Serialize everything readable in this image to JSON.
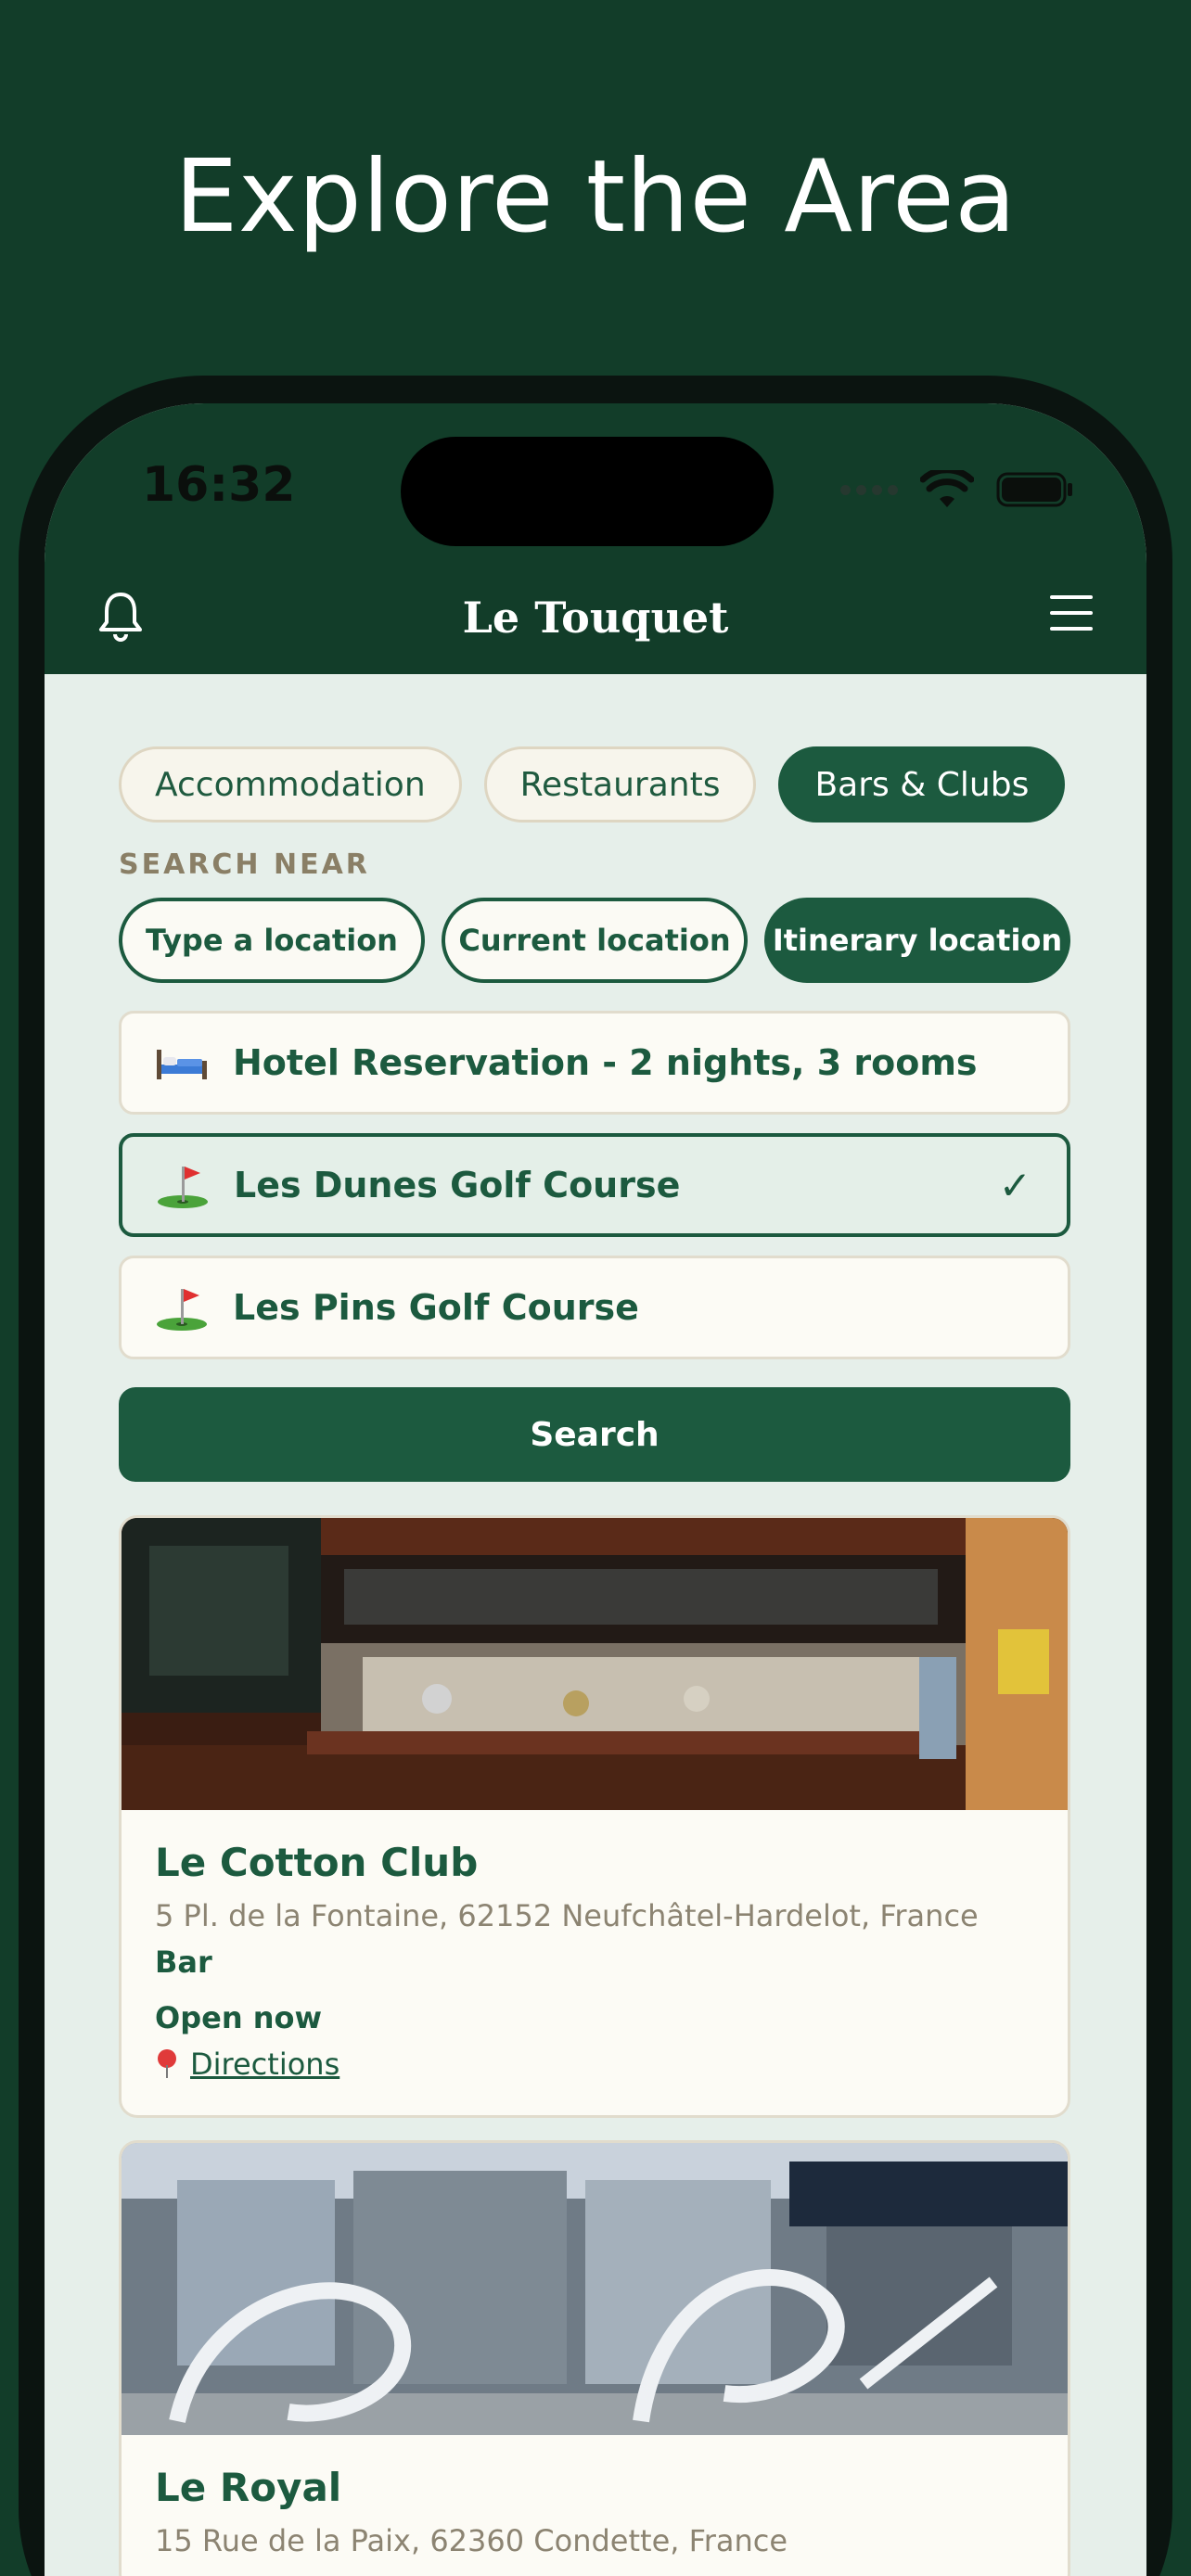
{
  "headline": "Explore the Area",
  "status_bar": {
    "time": "16:32"
  },
  "nav": {
    "title": "Le Touquet",
    "bell_icon": "bell-icon",
    "menu_icon": "hamburger-menu-icon"
  },
  "categories": [
    {
      "label": "Accommodation",
      "active": false
    },
    {
      "label": "Restaurants",
      "active": false
    },
    {
      "label": "Bars & Clubs",
      "active": true
    }
  ],
  "search_near": {
    "label": "SEARCH NEAR",
    "options": [
      {
        "label": "Type a location",
        "active": false
      },
      {
        "label": "Current location",
        "active": false
      },
      {
        "label": "Itinerary location",
        "active": true
      }
    ]
  },
  "itinerary_items": [
    {
      "icon": "bed-icon",
      "label": "Hotel Reservation - 2 nights, 3 rooms",
      "selected": false
    },
    {
      "icon": "golf-flag-icon",
      "label": "Les Dunes Golf Course",
      "selected": true,
      "check": "✓"
    },
    {
      "icon": "golf-flag-icon",
      "label": "Les Pins Golf Course",
      "selected": false
    }
  ],
  "search_button": "Search",
  "results": [
    {
      "name": "Le Cotton Club",
      "address": "5 Pl. de la Fontaine, 62152 Neufchâtel-Hardelot, France",
      "type": "Bar",
      "status": "Open now",
      "directions": "Directions"
    },
    {
      "name": "Le Royal",
      "address": "15 Rue de la Paix, 62360 Condette, France"
    }
  ],
  "colors": {
    "brand": "#123d29",
    "accent": "#1c5a3f",
    "background": "#e6efea"
  }
}
